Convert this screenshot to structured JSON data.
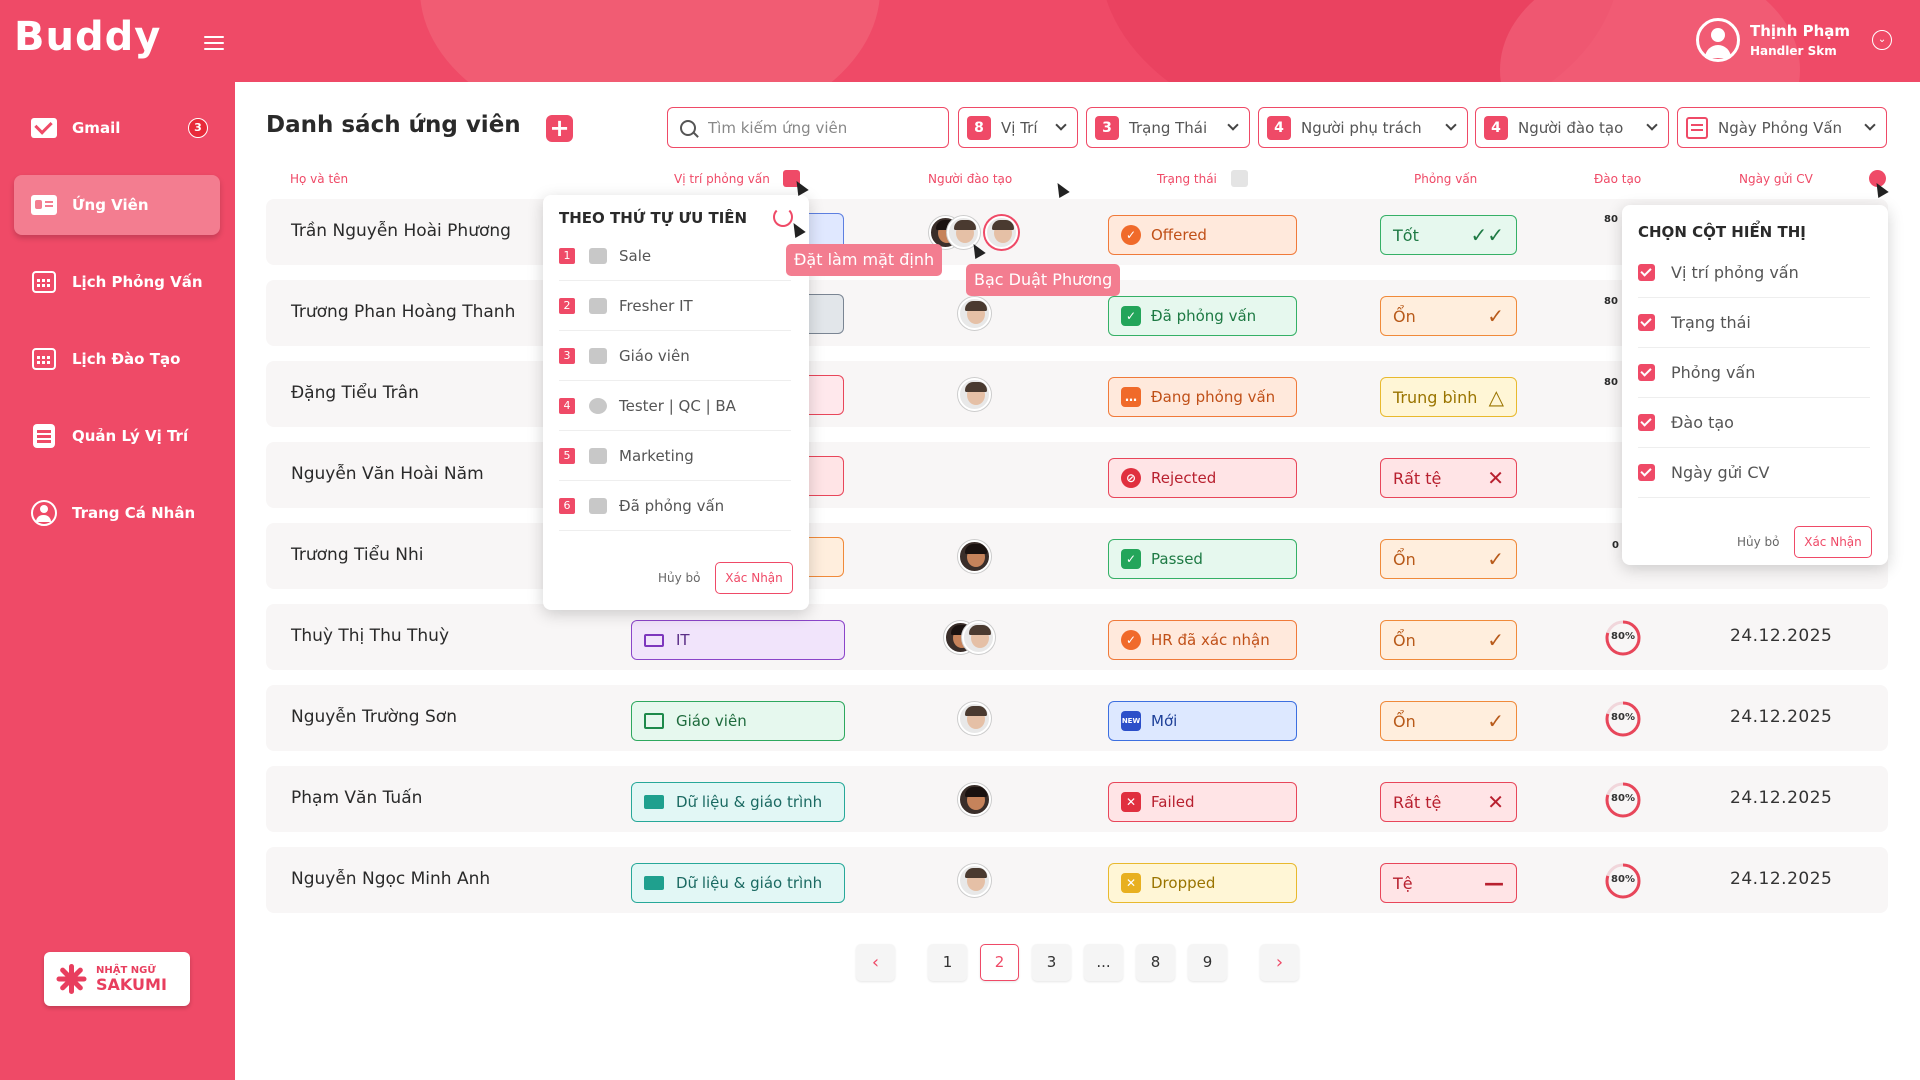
{
  "brand": {
    "logo": "Buddy",
    "partner_line1": "NHẬT NGỮ",
    "partner_line2": "SAKUMI"
  },
  "user": {
    "name": "Thịnh Phạm",
    "role": "Handler Skm"
  },
  "sidebar": {
    "items": [
      {
        "label": "Gmail",
        "badge": "3"
      },
      {
        "label": "Ứng Viên"
      },
      {
        "label": "Lịch Phỏng Vấn"
      },
      {
        "label": "Lịch Đào Tạo"
      },
      {
        "label": "Quản Lý Vị Trí"
      },
      {
        "label": "Trang Cá Nhân"
      }
    ]
  },
  "page": {
    "title": "Danh sách ứng viên"
  },
  "search": {
    "placeholder": "Tìm kiếm ứng viên"
  },
  "filters": [
    {
      "count": "8",
      "label": "Vị Trí"
    },
    {
      "count": "3",
      "label": "Trạng Thái"
    },
    {
      "count": "4",
      "label": "Người phụ trách"
    },
    {
      "count": "4",
      "label": "Người đào tạo"
    },
    {
      "label": "Ngày Phỏng Vấn"
    }
  ],
  "columns": [
    "Họ và tên",
    "Vị trí phỏng vấn",
    "Người đào tạo",
    "Trạng thái",
    "Phỏng vấn",
    "Đào tạo",
    "Ngày gửi CV"
  ],
  "rows": [
    {
      "name": "Trần Nguyễn Hoài Phương",
      "status": "Offered",
      "eval": "Tốt",
      "eval_mark": "✓✓"
    },
    {
      "name": "Trương Phan Hoàng Thanh",
      "status": "Đã phỏng vấn",
      "eval": "Ổn",
      "eval_mark": "✓"
    },
    {
      "name": "Đặng Tiểu Trân",
      "status": "Đang phỏng vấn",
      "eval": "Trung bình",
      "eval_mark": "△"
    },
    {
      "name": "Nguyễn Văn Hoài Năm",
      "status": "Rejected",
      "eval": "Rất tệ",
      "eval_mark": "✕"
    },
    {
      "name": "Trương Tiểu Nhi",
      "status": "Passed",
      "eval": "Ổn",
      "eval_mark": "✓"
    },
    {
      "name": "Thuỳ Thị Thu Thuỳ",
      "position": "IT",
      "status": "HR đã xác nhận",
      "eval": "Ổn",
      "eval_mark": "✓",
      "training": "80%",
      "training_value": 80,
      "date": "24.12.2025"
    },
    {
      "name": "Nguyễn Trường Sơn",
      "position": "Giáo viên",
      "status": "Mới",
      "eval": "Ổn",
      "eval_mark": "✓",
      "training": "80%",
      "training_value": 80,
      "date": "24.12.2025"
    },
    {
      "name": "Phạm Văn Tuấn",
      "position": "Dữ liệu & giáo trình",
      "status": "Failed",
      "eval": "Rất tệ",
      "eval_mark": "✕",
      "training": "80%",
      "training_value": 80,
      "date": "24.12.2025"
    },
    {
      "name": "Nguyễn Ngọc Minh Anh",
      "position": "Dữ liệu & giáo trình",
      "status": "Dropped",
      "eval": "Tệ",
      "eval_mark": "—",
      "training": "80%",
      "training_value": 80,
      "date": "24.12.2025"
    }
  ],
  "priority_panel": {
    "title": "THEO THỨ TỰ ƯU TIÊN",
    "items": [
      {
        "num": "1",
        "label": "Sale"
      },
      {
        "num": "2",
        "label": "Fresher IT"
      },
      {
        "num": "3",
        "label": "Giáo viên"
      },
      {
        "num": "4",
        "label": "Tester | QC | BA"
      },
      {
        "num": "5",
        "label": "Marketing"
      },
      {
        "num": "6",
        "label": "Đã phỏng vấn"
      }
    ],
    "cancel": "Hủy bỏ",
    "confirm": "Xác Nhận"
  },
  "column_panel": {
    "title": "CHỌN CỘT HIỂN THỊ",
    "items": [
      "Vị trí phỏng vấn",
      "Trạng thái",
      "Phỏng vấn",
      "Đào tạo",
      "Ngày gửi CV"
    ],
    "cancel": "Hủy bỏ",
    "confirm": "Xác Nhận"
  },
  "tooltips": {
    "set_default": "Đặt làm mặt định",
    "trainer_name": "Bạc Duật Phương"
  },
  "partial_ring_labels": {
    "row1": "80",
    "row2": "80",
    "row3": "80",
    "row5": "0"
  },
  "pagination": {
    "prev": "‹",
    "pages": [
      "1",
      "2",
      "3",
      "...",
      "8",
      "9"
    ],
    "next": "›",
    "current": "2"
  },
  "colors": {
    "primary": "#ef4a67",
    "sidebar": "#ef4a67"
  }
}
